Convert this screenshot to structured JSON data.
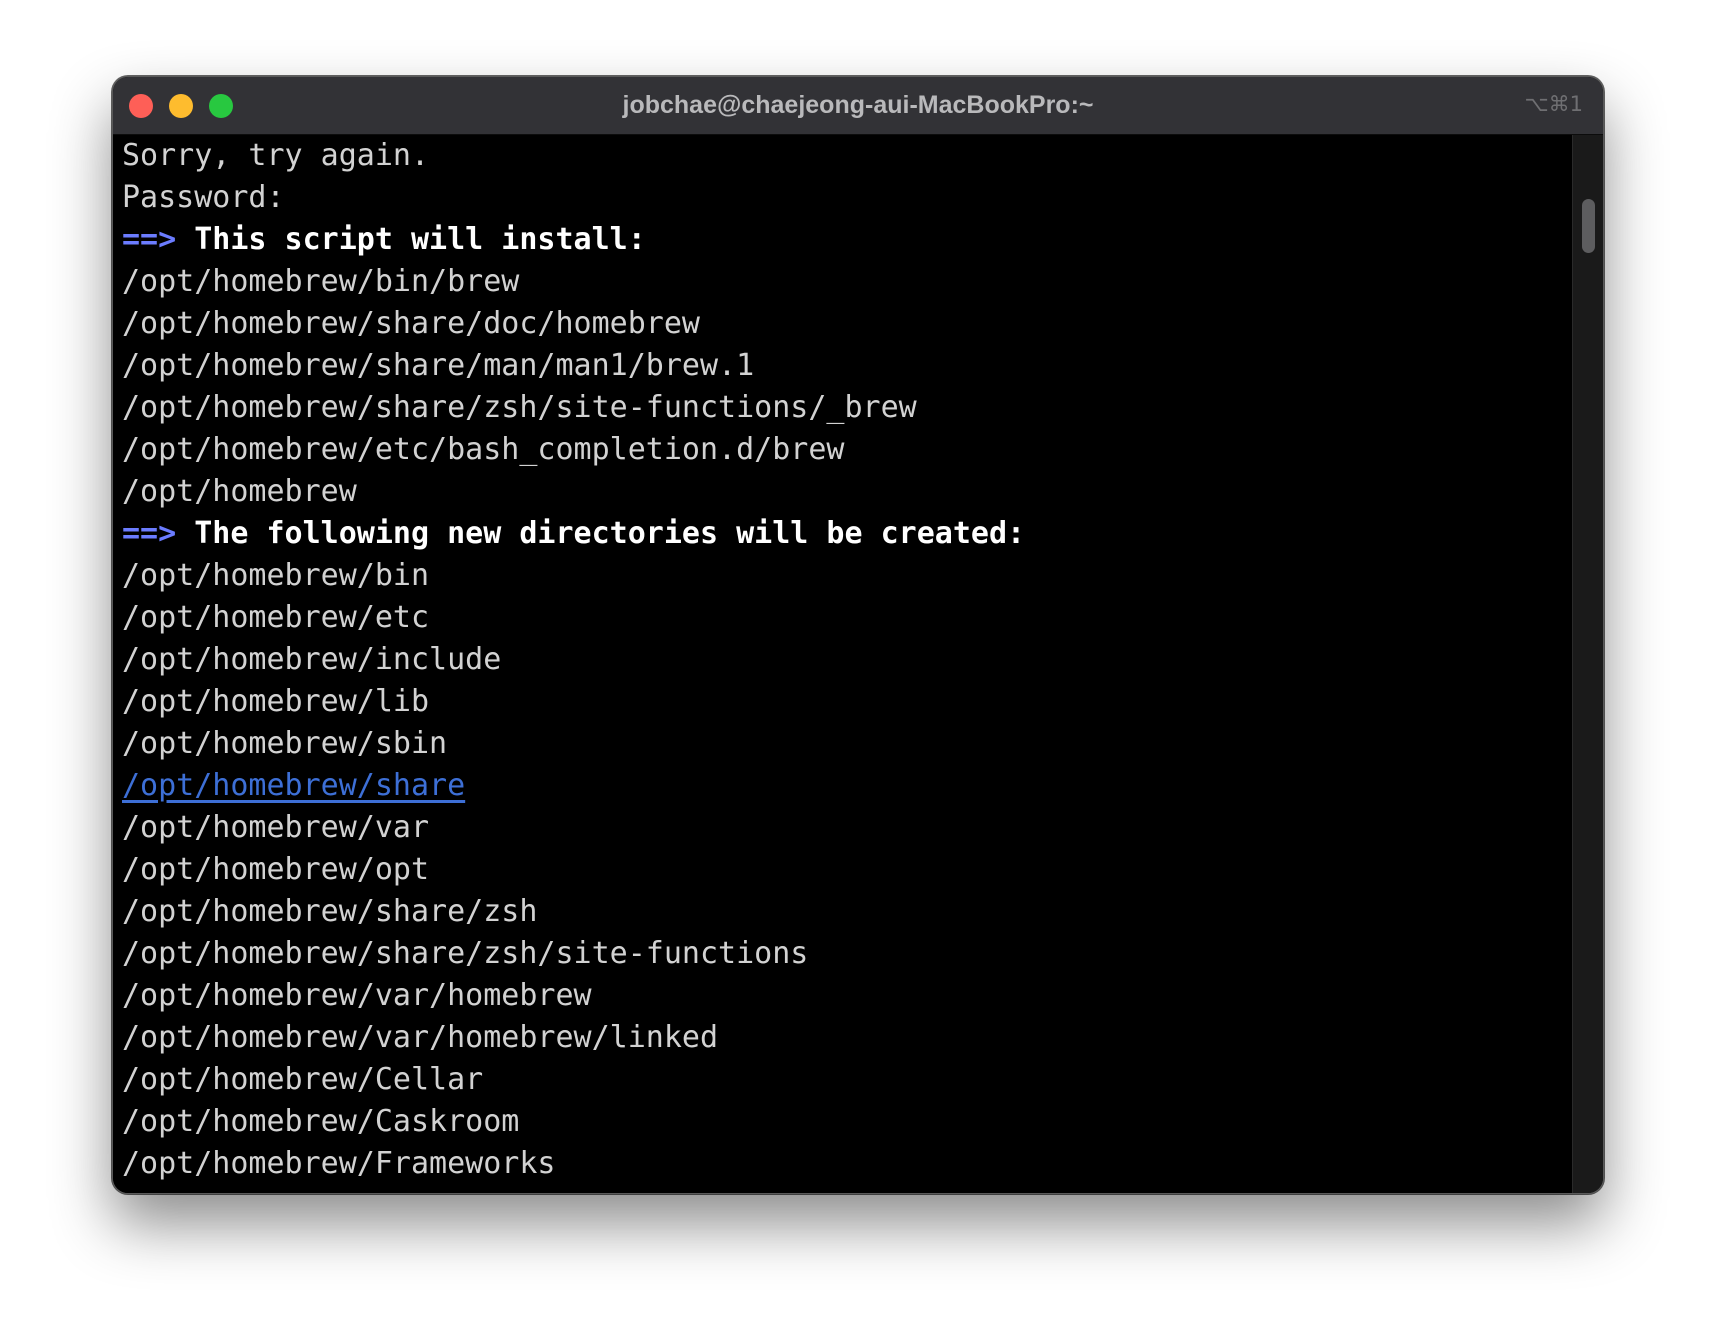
{
  "window": {
    "title": "jobchae@chaejeong-aui-MacBookPro:~",
    "shortcut": "⌥⌘1"
  },
  "terminal": {
    "lines": [
      {
        "type": "plain",
        "text": "Sorry, try again."
      },
      {
        "type": "plain",
        "text": "Password:"
      },
      {
        "type": "heading",
        "arrow": "==>",
        "text": "This script will install:"
      },
      {
        "type": "plain",
        "text": "/opt/homebrew/bin/brew"
      },
      {
        "type": "plain",
        "text": "/opt/homebrew/share/doc/homebrew"
      },
      {
        "type": "plain",
        "text": "/opt/homebrew/share/man/man1/brew.1"
      },
      {
        "type": "plain",
        "text": "/opt/homebrew/share/zsh/site-functions/_brew"
      },
      {
        "type": "plain",
        "text": "/opt/homebrew/etc/bash_completion.d/brew"
      },
      {
        "type": "plain",
        "text": "/opt/homebrew"
      },
      {
        "type": "heading",
        "arrow": "==>",
        "text": "The following new directories will be created:"
      },
      {
        "type": "plain",
        "text": "/opt/homebrew/bin"
      },
      {
        "type": "plain",
        "text": "/opt/homebrew/etc"
      },
      {
        "type": "plain",
        "text": "/opt/homebrew/include"
      },
      {
        "type": "plain",
        "text": "/opt/homebrew/lib"
      },
      {
        "type": "plain",
        "text": "/opt/homebrew/sbin"
      },
      {
        "type": "link",
        "text": "/opt/homebrew/share"
      },
      {
        "type": "plain",
        "text": "/opt/homebrew/var"
      },
      {
        "type": "plain",
        "text": "/opt/homebrew/opt"
      },
      {
        "type": "plain",
        "text": "/opt/homebrew/share/zsh"
      },
      {
        "type": "plain",
        "text": "/opt/homebrew/share/zsh/site-functions"
      },
      {
        "type": "plain",
        "text": "/opt/homebrew/var/homebrew"
      },
      {
        "type": "plain",
        "text": "/opt/homebrew/var/homebrew/linked"
      },
      {
        "type": "plain",
        "text": "/opt/homebrew/Cellar"
      },
      {
        "type": "plain",
        "text": "/opt/homebrew/Caskroom"
      },
      {
        "type": "plain",
        "text": "/opt/homebrew/Frameworks"
      }
    ]
  },
  "colors": {
    "background": "#000000",
    "text": "#d2d2d2",
    "heading": "#ffffff",
    "arrow": "#6b7cff",
    "link": "#3d6fd6",
    "close": "#fe5f57",
    "minimize": "#febc2e",
    "zoom": "#28c840"
  }
}
